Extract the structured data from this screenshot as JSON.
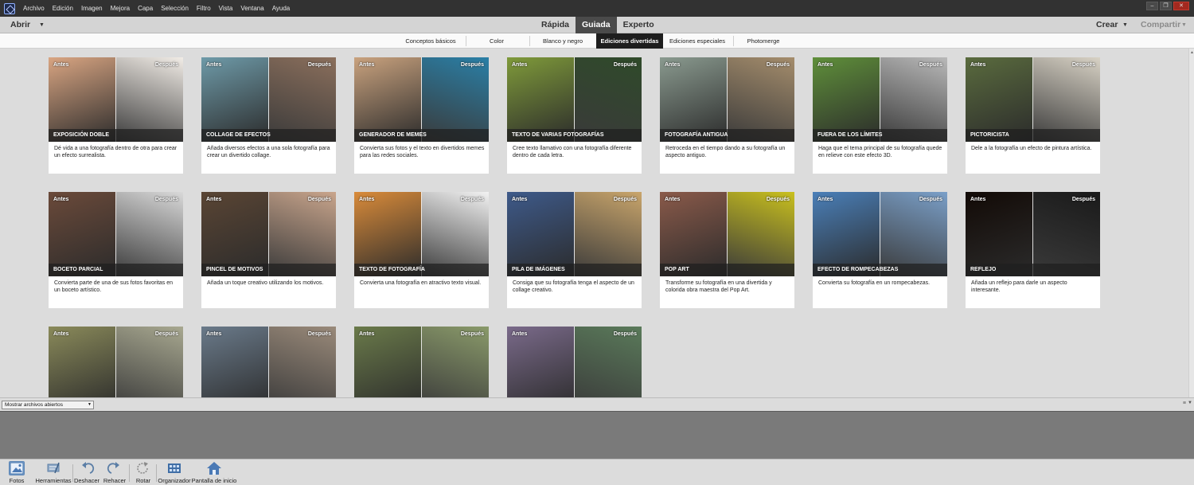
{
  "menubar": {
    "items": [
      "Archivo",
      "Edición",
      "Imagen",
      "Mejora",
      "Capa",
      "Selección",
      "Filtro",
      "Vista",
      "Ventana",
      "Ayuda"
    ],
    "controls": [
      "minimize-icon",
      "restore-icon",
      "close-icon"
    ]
  },
  "modebar": {
    "open_label": "Abrir",
    "tabs": [
      {
        "label": "Rápida",
        "active": false
      },
      {
        "label": "Guiada",
        "active": true
      },
      {
        "label": "Experto",
        "active": false
      }
    ],
    "create_label": "Crear",
    "share_label": "Compartir"
  },
  "subtabs": [
    {
      "label": "Conceptos básicos",
      "active": false
    },
    {
      "label": "Color",
      "active": false
    },
    {
      "label": "Blanco y negro",
      "active": false
    },
    {
      "label": "Ediciones divertidas",
      "active": true
    },
    {
      "label": "Ediciones especiales",
      "active": false
    },
    {
      "label": "Photomerge",
      "active": false
    }
  ],
  "card_labels": {
    "before": "Antes",
    "after": "Después"
  },
  "cards": [
    {
      "title": "EXPOSICIÓN DOBLE",
      "description": "Dé vida a una fotografía dentro de otra para crear un efecto surrealista.",
      "colors": [
        "#d9a582",
        "#f1ece6"
      ]
    },
    {
      "title": "COLLAGE DE EFECTOS",
      "description": "Añada diversos efectos a una sola fotografía para crear un divertido collage.",
      "colors": [
        "#6e9aa8",
        "#8b6f5c"
      ]
    },
    {
      "title": "GENERADOR DE MEMES",
      "description": "Convierta sus fotos y el texto en divertidos memes para las redes sociales.",
      "colors": [
        "#c9a27e",
        "#2a7fa6"
      ]
    },
    {
      "title": "TEXTO DE VARIAS FOTOGRAFÍAS",
      "description": "Cree texto llamativo con una fotografía diferente dentro de cada letra.",
      "colors": [
        "#7f9a3a",
        "#2f4a2a"
      ]
    },
    {
      "title": "FOTOGRAFÍA ANTIGUA",
      "description": "Retroceda en el tiempo dando a su fotografía un aspecto antiguo.",
      "colors": [
        "#8a9a8f",
        "#a58d6c"
      ]
    },
    {
      "title": "FUERA DE LOS LÍMITES",
      "description": "Haga que el tema principal de su fotografía quede en relieve con este efecto 3D.",
      "colors": [
        "#5f8f3a",
        "#b9b9b9"
      ]
    },
    {
      "title": "PICTORICISTA",
      "description": "Dele a la fotografía un efecto de pintura artística.",
      "colors": [
        "#5a6b3e",
        "#d8d2c5"
      ]
    },
    {
      "title": "BOCETO PARCIAL",
      "description": "Convierta parte de una de sus fotos favoritas en un boceto artístico.",
      "colors": [
        "#6b4a3a",
        "#d9d9d9"
      ]
    },
    {
      "title": "PINCEL DE MOTIVOS",
      "description": "Añada un toque creativo utilizando los motivos.",
      "colors": [
        "#5a4534",
        "#c9a58c"
      ]
    },
    {
      "title": "TEXTO DE FOTOGRAFÍA",
      "description": "Convierta una fotografía en atractivo texto visual.",
      "colors": [
        "#d98b3a",
        "#f2f2f2"
      ]
    },
    {
      "title": "PILA DE IMÁGENES",
      "description": "Consiga que su fotografía tenga el aspecto de un collage creativo.",
      "colors": [
        "#3e5a8a",
        "#c9a56b"
      ]
    },
    {
      "title": "POP ART",
      "description": "Transforme su fotografía en una divertida y colorida obra maestra del Pop Art.",
      "colors": [
        "#8a5a4a",
        "#c9c01e"
      ]
    },
    {
      "title": "EFECTO DE ROMPECABEZAS",
      "description": "Convierta su fotografía en un rompecabezas.",
      "colors": [
        "#4a7fb8",
        "#7a9fc8"
      ]
    },
    {
      "title": "REFLEJO",
      "description": "Añada un reflejo para darle un aspecto interesante.",
      "colors": [
        "#120a06",
        "#1a1a1a"
      ]
    },
    {
      "title": "",
      "description": "",
      "colors": [
        "#8a8a5a",
        "#a8a890"
      ]
    },
    {
      "title": "",
      "description": "",
      "colors": [
        "#6a7a8a",
        "#9a8a7a"
      ]
    },
    {
      "title": "",
      "description": "",
      "colors": [
        "#6a7a4a",
        "#8a9a6a"
      ]
    },
    {
      "title": "",
      "description": "",
      "colors": [
        "#7a6a8a",
        "#5a7a5a"
      ]
    }
  ],
  "filebar": {
    "select_value": "Mostrar archivos abiertos"
  },
  "taskbar": {
    "items": [
      {
        "label": "Fotos",
        "icon": "photos-icon",
        "active": true
      },
      {
        "label": "Herramientas",
        "icon": "tools-icon",
        "active": false
      },
      {
        "label": "Deshacer",
        "icon": "undo-icon",
        "active": false
      },
      {
        "label": "Rehacer",
        "icon": "redo-icon",
        "active": false
      },
      {
        "label": "Rotar",
        "icon": "rotate-icon",
        "active": false
      },
      {
        "label": "Organizador",
        "icon": "organizer-icon",
        "active": false
      },
      {
        "label": "Pantalla de inicio",
        "icon": "home-icon",
        "active": false
      }
    ]
  }
}
